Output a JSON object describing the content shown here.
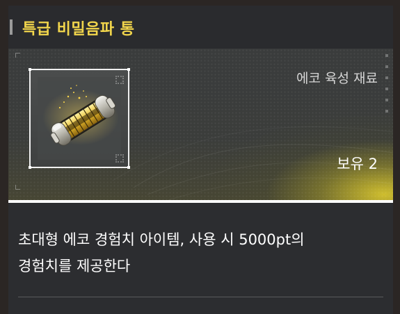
{
  "item": {
    "name": "특급 비밀음파 통",
    "category": "에코 육성 재료",
    "owned_label": "보유",
    "owned_count": "2",
    "description_line1": "초대형 에코 경험치 아이템, 사용 시 5000pt의",
    "description_line2": "경험치를 제공한다",
    "icon": "sonic-canister-icon"
  },
  "colors": {
    "title": "#f2d64c",
    "accent_glow": "#d6c42e",
    "panel_bg": "#2c2d30"
  }
}
